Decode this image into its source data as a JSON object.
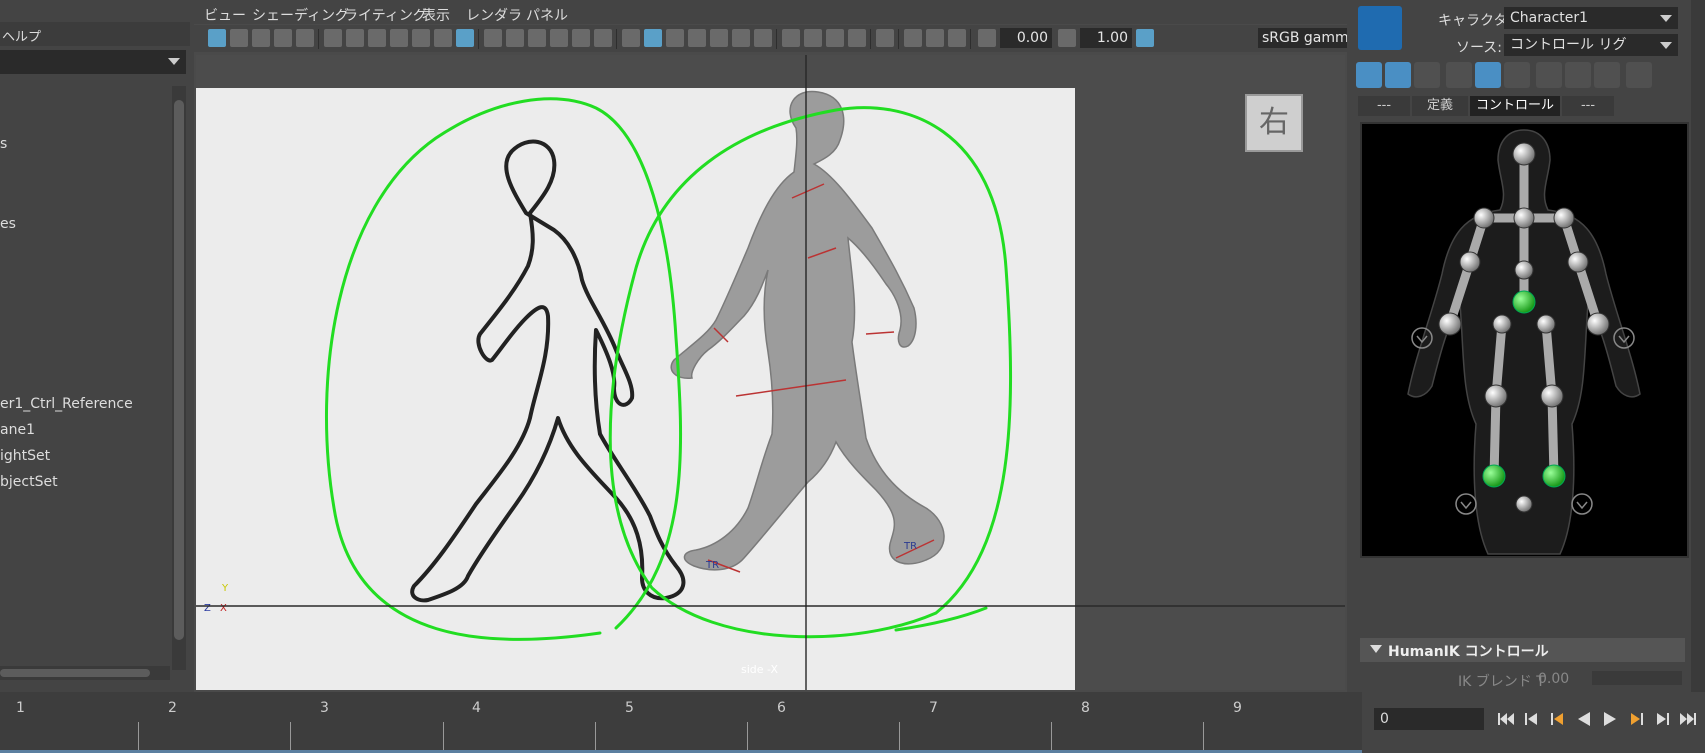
{
  "outliner": {
    "menu_help": "ヘルプ",
    "items": [
      "s",
      "es",
      "er1_Ctrl_Reference",
      "ane1",
      "ightSet",
      "bjectSet"
    ]
  },
  "viewport": {
    "menu": [
      "ビュー",
      "シェーディング",
      "ライティング",
      "表示",
      "レンダラ",
      "パネル"
    ],
    "exposure": "0.00",
    "gamma": "1.00",
    "colorspace": "sRGB gamma",
    "viewcube_label": "右",
    "camera_label": "side -X",
    "axis_y": "Y",
    "axis_z": "Z",
    "axis_x": "X",
    "annotation_color": "#22dd22",
    "tr_label": "TR"
  },
  "hik": {
    "character_label": "キャラクタ:",
    "character_value": "Character1",
    "source_label": "ソース:",
    "source_value": "コントロール リグ",
    "tabs": [
      "---",
      "定義",
      "コントロール",
      "---"
    ],
    "active_tab": "コントロール",
    "section_title": "HumanIK コントロール",
    "ik_blend_label": "IK ブレンド T",
    "ik_blend_value": "0.00",
    "accent_color": "#4a8fc4",
    "effector_active_color": "#33cc33"
  },
  "timeline": {
    "ticks": [
      "1",
      "2",
      "3",
      "4",
      "5",
      "6",
      "7",
      "8",
      "9"
    ],
    "current_frame": "0"
  }
}
